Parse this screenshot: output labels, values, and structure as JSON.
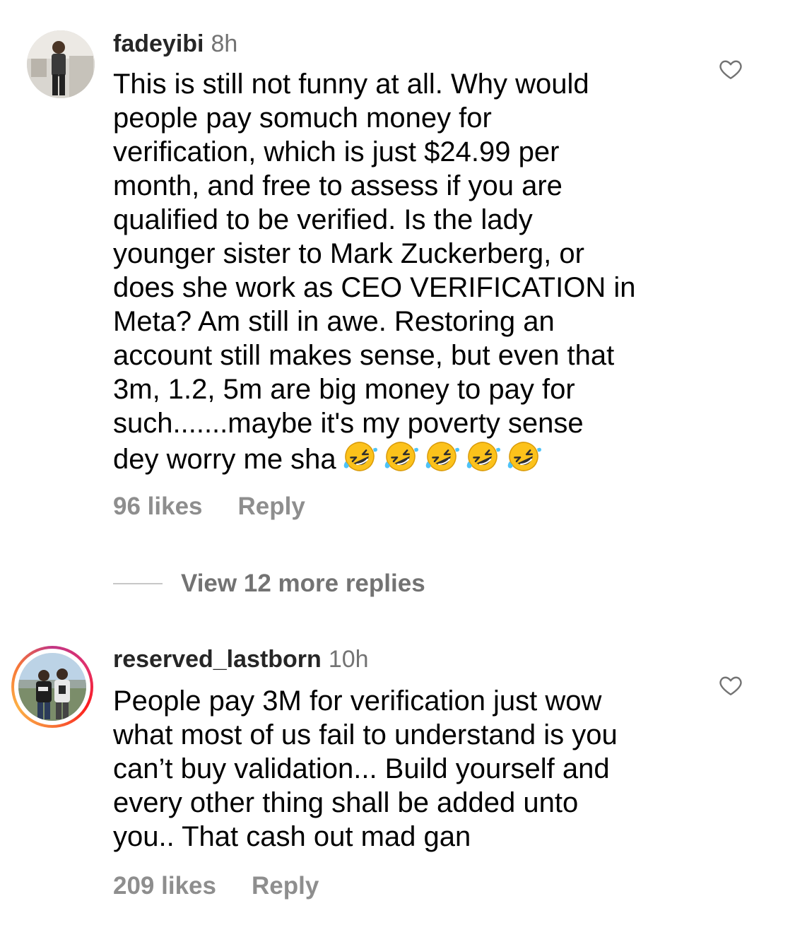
{
  "comments": [
    {
      "username": "fadeyibi",
      "time": "8h",
      "text": "This is still not funny at all. Why would\npeople pay somuch money for\nverification, which is just $24.99 per\nmonth, and free to assess if you are\nqualified to be verified. Is the lady\nyounger sister to Mark Zuckerberg, or\ndoes she work as CEO VERIFICATION in\nMeta? Am still in awe. Restoring an\naccount still makes sense, but even that\n3m, 1.2, 5m are big money to pay for\nsuch.......maybe it's my poverty sense\ndey worry me sha",
      "emoji": "rolling-on-floor-laughing",
      "emoji_count": 5,
      "likes": "96 likes",
      "reply_label": "Reply",
      "view_replies": "View 12 more replies",
      "has_story_ring": false
    },
    {
      "username": "reserved_lastborn",
      "time": "10h",
      "text": "People pay 3M for verification just wow\nwhat most of us fail to understand is you\ncan’t buy validation... Build yourself and\nevery other thing shall be added unto\nyou.. That cash out mad gan",
      "likes": "209 likes",
      "reply_label": "Reply",
      "has_story_ring": true
    }
  ],
  "colors": {
    "username": "#262626",
    "secondary": "#737373",
    "meta": "#8e8e8e",
    "divider": "#c7c7c7"
  },
  "icons": {
    "like": "heart-outline-icon",
    "emoji": "rolling-on-floor-laughing-emoji"
  }
}
